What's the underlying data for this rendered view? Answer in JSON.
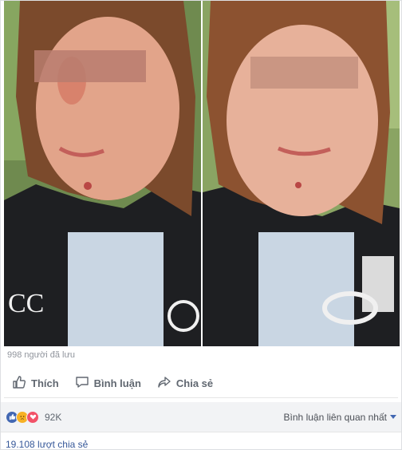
{
  "post": {
    "saved_text": "998 người đã lưu",
    "actions": [
      {
        "label": "Thích",
        "icon": "like-icon"
      },
      {
        "label": "Bình luận",
        "icon": "comment-icon"
      },
      {
        "label": "Chia sẻ",
        "icon": "share-icon"
      }
    ],
    "reactions": {
      "icons": [
        "like-reaction-icon",
        "sad-reaction-icon",
        "love-reaction-icon"
      ],
      "count": "92K",
      "colors": {
        "like": "#4267b2",
        "sad": "#f7b125",
        "love": "#f25268"
      }
    },
    "comment_sort": "Bình luận liên quan nhất",
    "shares_text": "19.108 lượt chia sẻ"
  }
}
